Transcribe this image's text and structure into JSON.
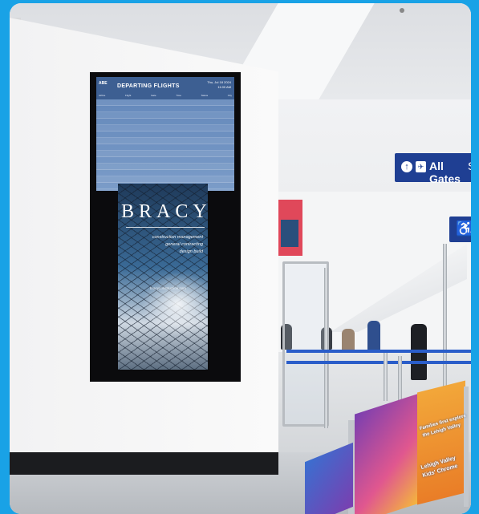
{
  "scene": "airport terminal",
  "fids": {
    "logo": "ABE",
    "title": "DEPARTING FLIGHTS",
    "date": "Thu, Jul 18 2024",
    "time": "11:00 AM",
    "columns": [
      "Airline",
      "Flight",
      "Gate",
      "Time",
      "Status",
      "City"
    ],
    "rows": [
      [
        "",
        "",
        "",
        "",
        "",
        ""
      ],
      [
        "",
        "",
        "",
        "",
        "",
        ""
      ],
      [
        "",
        "",
        "",
        "",
        "",
        ""
      ],
      [
        "",
        "",
        "",
        "",
        "",
        ""
      ],
      [
        "",
        "",
        "",
        "",
        "",
        ""
      ],
      [
        "",
        "",
        "",
        "",
        "",
        ""
      ],
      [
        "",
        "",
        "",
        "",
        "",
        ""
      ],
      [
        "",
        "",
        "",
        "",
        "",
        ""
      ],
      [
        "",
        "",
        "",
        "",
        "",
        ""
      ],
      [
        "",
        "",
        "",
        "",
        "",
        ""
      ],
      [
        "",
        "",
        "",
        "",
        "",
        ""
      ],
      [
        "",
        "",
        "",
        "",
        "",
        ""
      ],
      [
        "",
        "",
        "",
        "",
        "",
        ""
      ],
      [
        "",
        "",
        "",
        "",
        "",
        ""
      ],
      [
        "",
        "",
        "",
        "",
        "",
        ""
      ]
    ]
  },
  "ad": {
    "brand": "BRACY",
    "tag1": "construction management",
    "tag2": "general contracting",
    "tag3": "design build",
    "url": "bracyconstruction.com"
  },
  "signs": {
    "gates_label": "All Gates",
    "gates_extra": "S",
    "gates_arrow": "↑",
    "gates_plane": "✈",
    "access_glyph": "♿",
    "access_letter": "A"
  },
  "kids_panel": {
    "line1": "Families first explore",
    "line2": "the Lehigh Valley",
    "line3": "Lehigh Valley",
    "line4": "Kids' Chrome"
  },
  "colors": {
    "frame": "#19a2e6",
    "sign_blue": "#1f3f93",
    "fids_blue": "#5f84b8",
    "belt_blue": "#2a5dc9"
  }
}
